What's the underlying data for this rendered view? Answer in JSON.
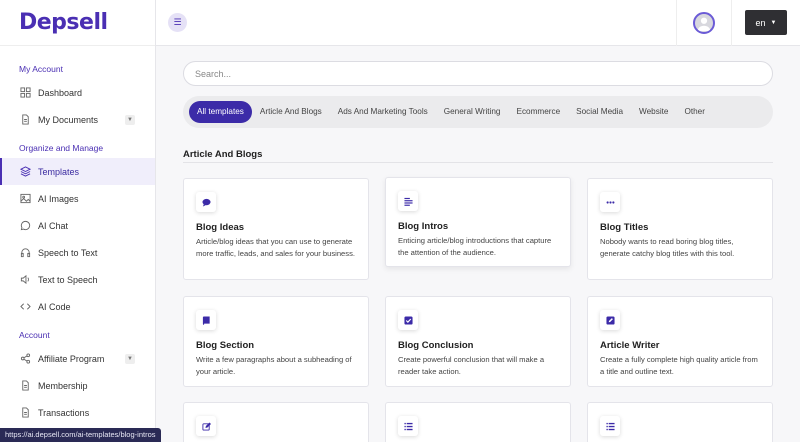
{
  "brand": {
    "logo_text": "Depsell",
    "accent": "#4a2fb3"
  },
  "header": {
    "language": "en"
  },
  "sidebar": {
    "sections": [
      {
        "label": "My Account",
        "items": [
          {
            "label": "Dashboard",
            "icon": "grid-icon"
          },
          {
            "label": "My Documents",
            "icon": "document-icon",
            "has_caret": true
          }
        ]
      },
      {
        "label": "Organize and Manage",
        "items": [
          {
            "label": "Templates",
            "icon": "layers-icon",
            "active": true
          },
          {
            "label": "AI Images",
            "icon": "image-icon"
          },
          {
            "label": "AI Chat",
            "icon": "chat-icon"
          },
          {
            "label": "Speech to Text",
            "icon": "headphones-icon"
          },
          {
            "label": "Text to Speech",
            "icon": "speaker-icon"
          },
          {
            "label": "AI Code",
            "icon": "code-icon"
          }
        ]
      },
      {
        "label": "Account",
        "items": [
          {
            "label": "Affiliate Program",
            "icon": "share-icon",
            "has_caret": true
          },
          {
            "label": "Membership",
            "icon": "document-icon"
          },
          {
            "label": "Transactions",
            "icon": "document-icon"
          }
        ]
      }
    ]
  },
  "search": {
    "placeholder": "Search..."
  },
  "tabs": [
    {
      "label": "All templates",
      "active": true
    },
    {
      "label": "Article And Blogs"
    },
    {
      "label": "Ads And Marketing Tools"
    },
    {
      "label": "General Writing"
    },
    {
      "label": "Ecommerce"
    },
    {
      "label": "Social Media"
    },
    {
      "label": "Website"
    },
    {
      "label": "Other"
    }
  ],
  "section_title": "Article And Blogs",
  "cards": [
    {
      "title": "Blog Ideas",
      "desc": "Article/blog ideas that you can use to generate more traffic, leads, and sales for your business.",
      "icon": "chat-bubble-icon"
    },
    {
      "title": "Blog Intros",
      "desc": "Enticing article/blog introductions that capture the attention of the audience.",
      "icon": "align-left-icon"
    },
    {
      "title": "Blog Titles",
      "desc": "Nobody wants to read boring blog titles, generate catchy blog titles with this tool.",
      "icon": "dots-icon"
    },
    {
      "title": "Blog Section",
      "desc": "Write a few paragraphs about a subheading of your article.",
      "icon": "book-icon"
    },
    {
      "title": "Blog Conclusion",
      "desc": "Create powerful conclusion that will make a reader take action.",
      "icon": "check-square-icon"
    },
    {
      "title": "Article Writer",
      "desc": "Create a fully complete high quality article from a title and outline text.",
      "icon": "pen-square-icon"
    },
    {
      "title": "",
      "desc": "",
      "icon": "edit-icon"
    },
    {
      "title": "",
      "desc": "",
      "icon": "list-icon"
    },
    {
      "title": "",
      "desc": "",
      "icon": "list-icon"
    }
  ],
  "status_url": "https://ai.depsell.com/ai-templates/blog-intros"
}
